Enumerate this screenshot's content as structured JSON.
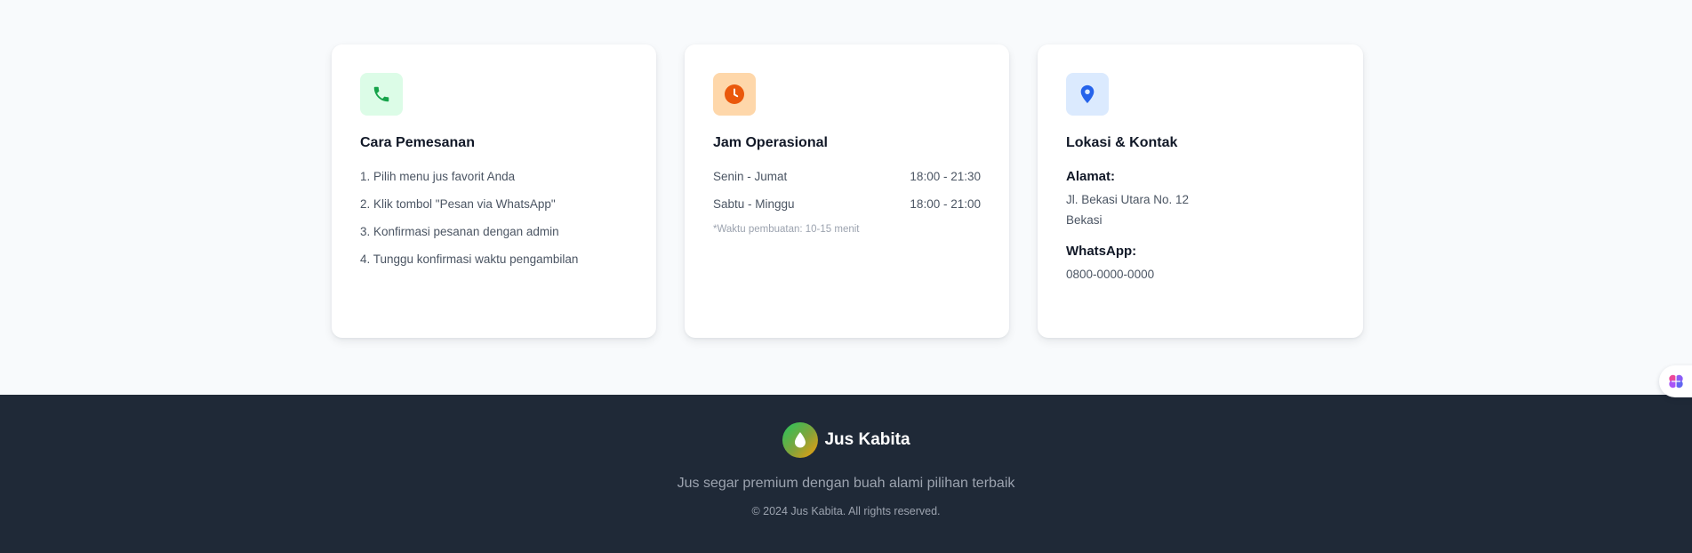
{
  "info_cards": {
    "ordering": {
      "icon": "phone-icon",
      "title": "Cara Pemesanan",
      "steps": [
        "1. Pilih menu jus favorit Anda",
        "2. Klik tombol \"Pesan via WhatsApp\"",
        "3. Konfirmasi pesanan dengan admin",
        "4. Tunggu konfirmasi waktu pengambilan"
      ]
    },
    "hours": {
      "icon": "clock-icon",
      "title": "Jam Operasional",
      "rows": [
        {
          "day": "Senin - Jumat",
          "time": "18:00 - 21:30"
        },
        {
          "day": "Sabtu - Minggu",
          "time": "18:00 - 21:00"
        }
      ],
      "note": "*Waktu pembuatan: 10-15 menit"
    },
    "location": {
      "icon": "map-pin-icon",
      "title": "Lokasi & Kontak",
      "address_label": "Alamat:",
      "address_line1": "Jl. Bekasi Utara No. 12",
      "address_line2": "Bekasi",
      "whatsapp_label": "WhatsApp:",
      "whatsapp_number": "0800-0000-0000"
    }
  },
  "footer": {
    "brand_name": "Jus Kabita",
    "tagline": "Jus segar premium dengan buah alami pilihan terbaik",
    "copyright": "© 2024 Jus Kabita. All rights reserved."
  },
  "colors": {
    "green_icon": "#16a34a",
    "orange_icon": "#ea580c",
    "blue_icon": "#2563eb",
    "footer_bg": "#1f2937",
    "page_bg": "#f8fafc"
  }
}
